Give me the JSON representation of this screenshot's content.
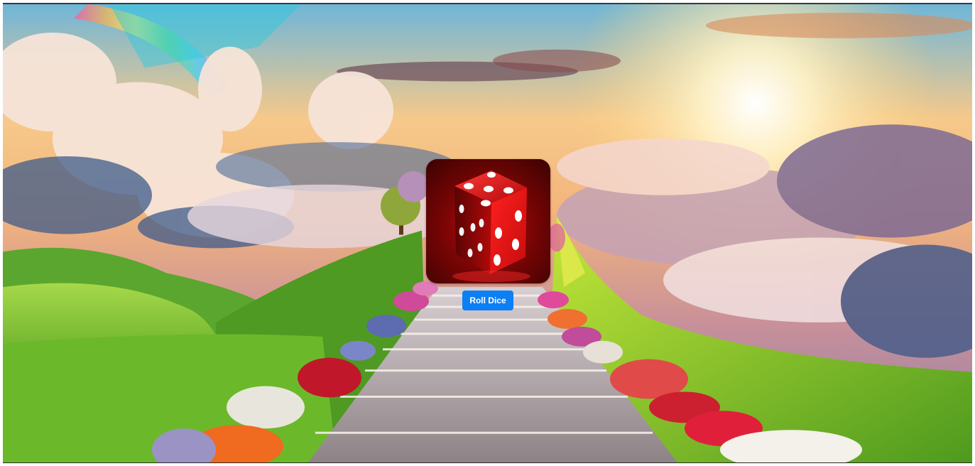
{
  "page": {
    "background": "heaven-stairway-landscape",
    "dice_image": "red-dice-icon"
  },
  "controls": {
    "roll_button_label": "Roll Dice"
  },
  "colors": {
    "button": "#0d7ff5",
    "button_text": "#ffffff",
    "dice": "#c2100f"
  }
}
